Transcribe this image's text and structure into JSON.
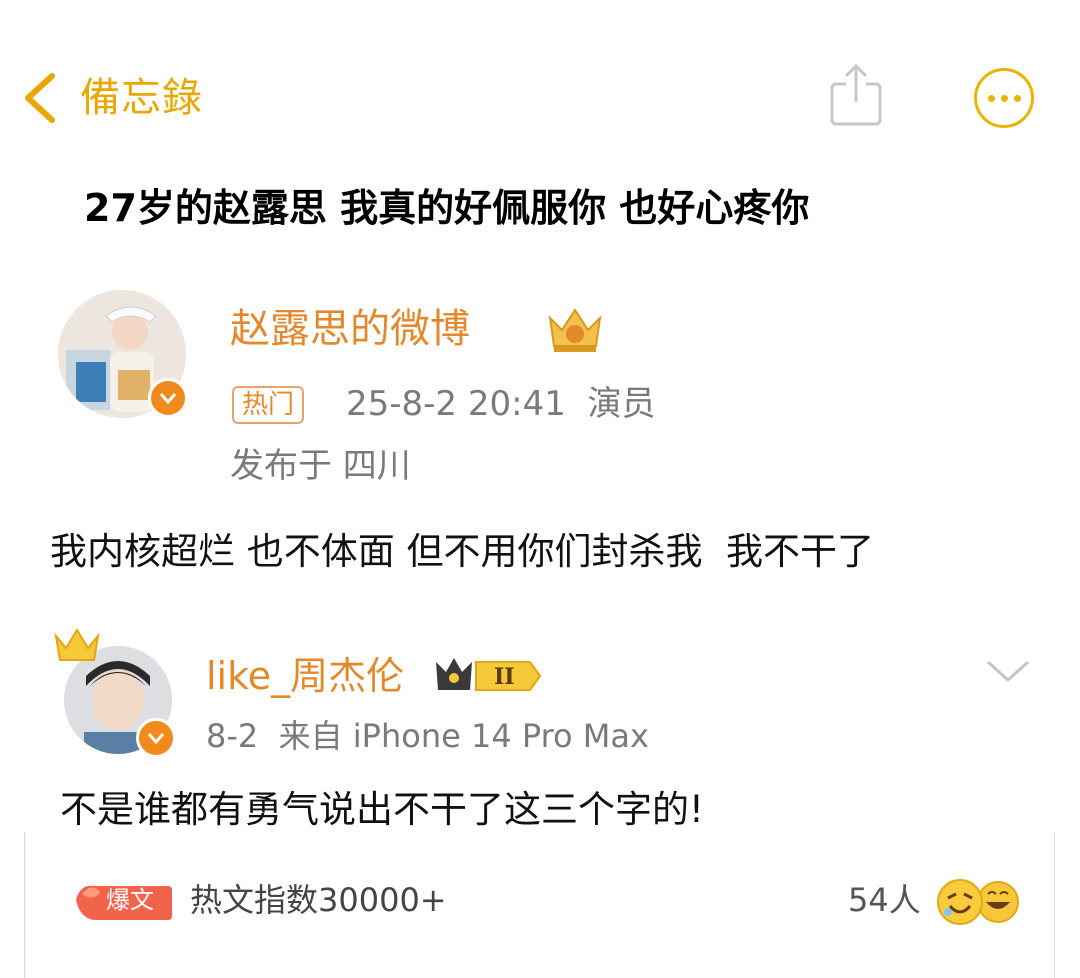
{
  "nav": {
    "back_label": "備忘錄",
    "accent": "#e8a800"
  },
  "headline": "27岁的赵露思 我真的好佩服你 也好心疼你",
  "post": {
    "author": "赵露思的微博",
    "hot_tag": "热门",
    "date_time": "25-8-2 20:41",
    "role": "演员",
    "location": "发布于 四川",
    "text": "我内核超烂 也不体面 但不用你们封杀我  我不干了"
  },
  "comment": {
    "author": "like_周杰伦",
    "level_badge": "II",
    "meta": "8-2  来自 iPhone 14 Pro Max",
    "text": "不是谁都有勇气说出不干了这三个字的!"
  },
  "hot_bar": {
    "badge_label": "爆文",
    "hot_index": "热文指数30000+",
    "people": "54人"
  },
  "icons": [
    "chevron-left-icon",
    "share-icon",
    "more-dots-icon",
    "crown-icon",
    "verified-icon",
    "chevron-down-icon",
    "emoji-icon"
  ]
}
